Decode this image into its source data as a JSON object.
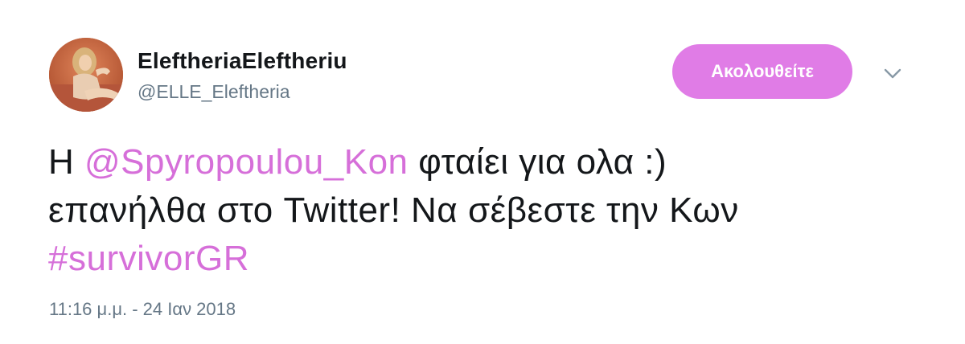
{
  "user": {
    "display_name": "EleftheriaEleftheriu",
    "handle": "@ELLE_Eleftheria",
    "avatar_icon": "profile-photo"
  },
  "actions": {
    "follow_label": "Ακολουθείτε",
    "menu_icon": "chevron-down-icon"
  },
  "tweet": {
    "line1_prefix": "Η",
    "mention": "@Spyropoulou_Kon",
    "line1_suffix": "φταίει για ολα :)",
    "line2": "επανήλθα στο Twitter! Να σέβεστε την Κων",
    "hashtag": "#survivorGR"
  },
  "meta": {
    "timestamp": "11:16 μ.μ. - 24 Ιαν 2018"
  },
  "colors": {
    "accent": "#d66fd9",
    "follow_button": "#e07ce6",
    "secondary_text": "#657786"
  }
}
